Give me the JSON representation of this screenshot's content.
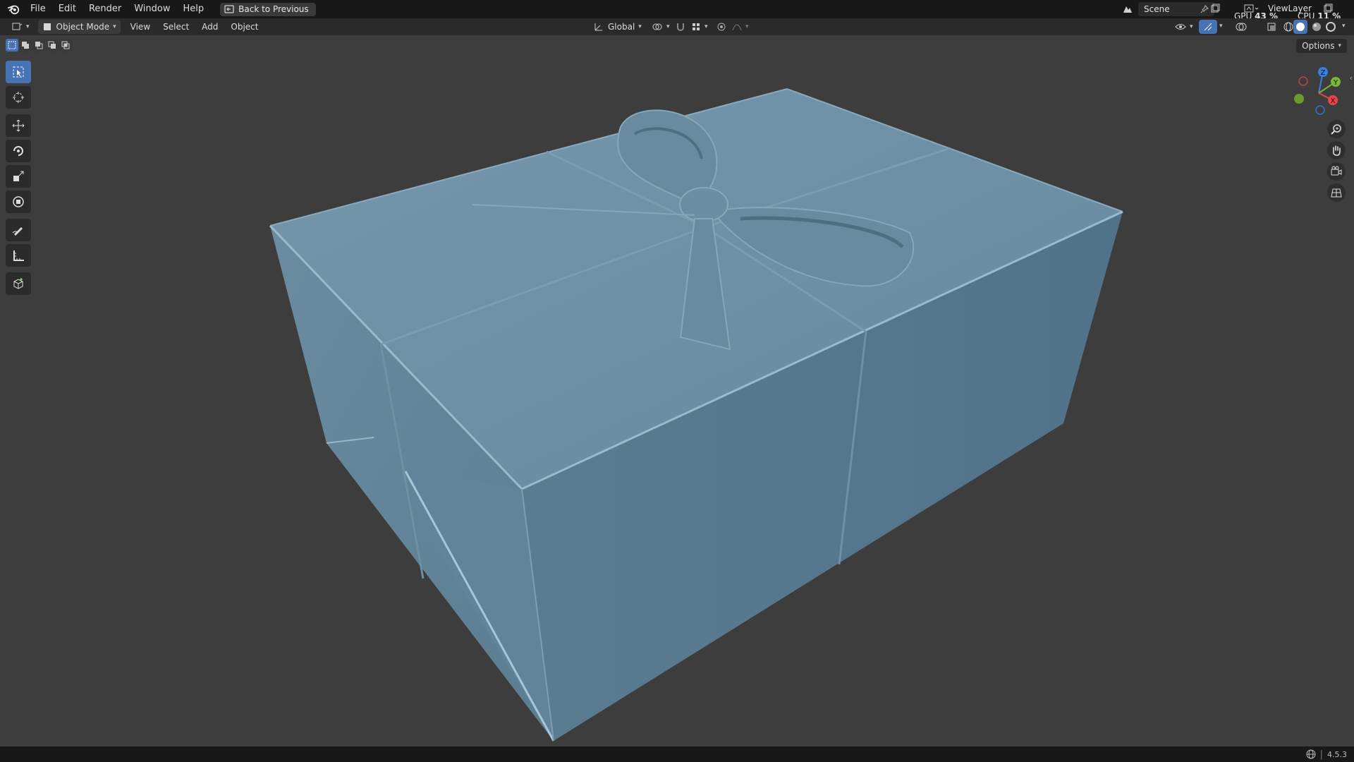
{
  "menubar": {
    "items": [
      "File",
      "Edit",
      "Render",
      "Window",
      "Help"
    ],
    "back_button": "Back to Previous",
    "scene_name": "Scene",
    "viewlayer_name": "ViewLayer",
    "gpu_label": "GPU",
    "gpu_value": "43 %",
    "cpu_label": "CPU",
    "cpu_value": "11 %"
  },
  "header": {
    "mode": "Object Mode",
    "menus": [
      "View",
      "Select",
      "Add",
      "Object"
    ],
    "transform_orientation": "Global"
  },
  "viewport": {
    "options_label": "Options",
    "gizmo_axes": [
      "Z",
      "Y",
      "X"
    ]
  },
  "toolbar": {
    "tools": [
      "select-box",
      "cursor",
      "move",
      "rotate",
      "scale",
      "transform",
      "annotate",
      "measure",
      "add-cube"
    ],
    "active_tool": "select-box"
  },
  "statusbar": {
    "version": "4.5.3"
  },
  "colors": {
    "accent": "#4772b3",
    "viewport_bg": "#3d3d3d",
    "model": "#6d8ea3"
  }
}
